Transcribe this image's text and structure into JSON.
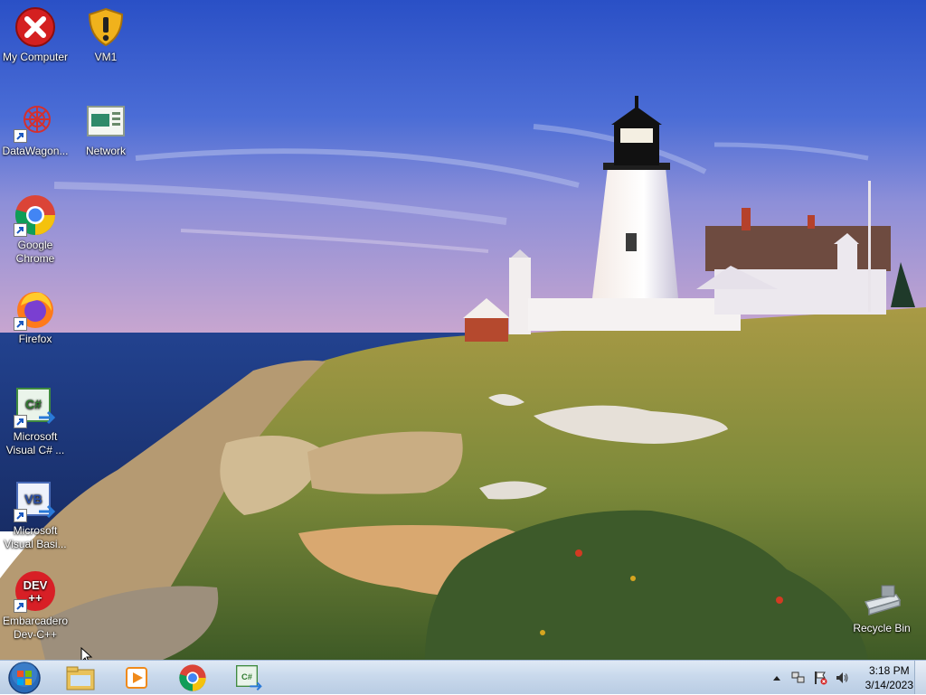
{
  "desktop": {
    "icons": [
      {
        "label": "My Computer",
        "icon": "error-x-icon"
      },
      {
        "label": "VM1",
        "icon": "warning-shield-icon"
      },
      {
        "label": "DataWagon...",
        "icon": "datawagon-icon"
      },
      {
        "label": "Network",
        "icon": "network-icon"
      },
      {
        "label": "Google Chrome",
        "icon": "chrome-icon"
      },
      {
        "label": "Firefox",
        "icon": "firefox-icon"
      },
      {
        "label": "Microsoft Visual C# ...",
        "icon": "visual-csharp-icon",
        "badge": "C#"
      },
      {
        "label": "Microsoft Visual Basi...",
        "icon": "visual-basic-icon",
        "badge": "VB"
      },
      {
        "label": "Embarcadero Dev-C++",
        "icon": "devcpp-icon",
        "badge": "DEV\n++"
      },
      {
        "label": "Recycle Bin",
        "icon": "recycle-bin-icon"
      }
    ]
  },
  "taskbar": {
    "pinned": [
      {
        "name": "windows-explorer",
        "icon": "folder-icon"
      },
      {
        "name": "media-player",
        "icon": "media-player-icon"
      },
      {
        "name": "google-chrome",
        "icon": "chrome-icon"
      },
      {
        "name": "visual-csharp",
        "icon": "visual-csharp-icon",
        "badge": "C#"
      }
    ],
    "tray": {
      "time": "3:18 PM",
      "date": "3/14/2023"
    }
  },
  "colors": {
    "sky_top": "#2f56c8",
    "sea": "#1c3b8a",
    "grass": "#8a8a3a",
    "taskbar": "#c9d9ec",
    "chrome_red": "#db4437",
    "chrome_yellow": "#f4c20d",
    "chrome_green": "#0f9d58",
    "chrome_blue": "#4285f4"
  }
}
